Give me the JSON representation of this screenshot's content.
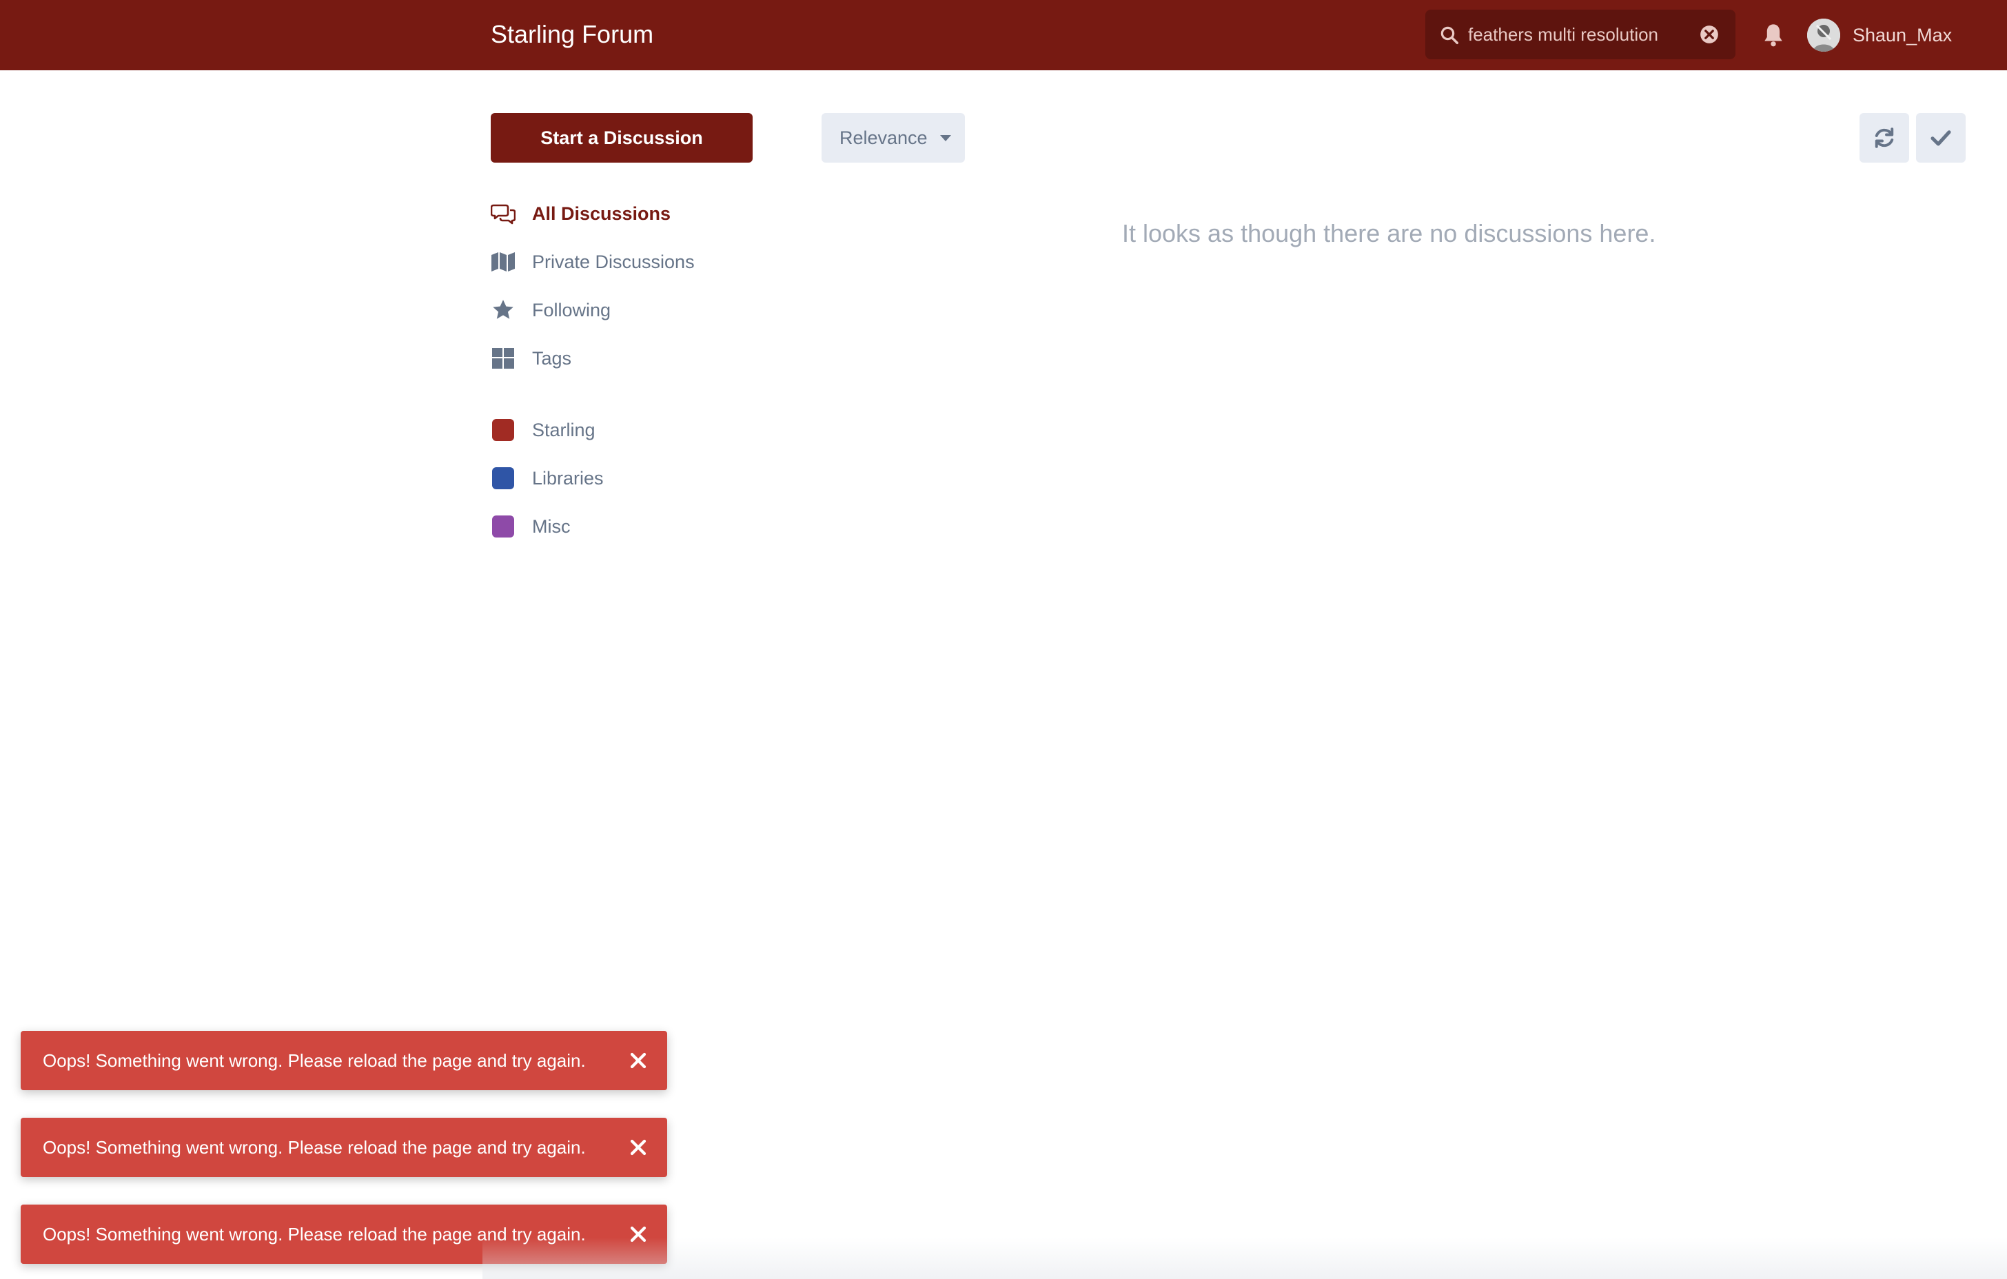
{
  "header": {
    "brand": "Starling Forum",
    "search_value": "feathers multi resolution",
    "username": "Shaun_Max",
    "icons": {
      "search": "search-icon",
      "clear": "clear-search-icon",
      "notifications": "bell-icon",
      "avatar": "avatar"
    }
  },
  "toolbar": {
    "start_label": "Start a Discussion",
    "sort_label": "Relevance",
    "refresh_icon": "refresh-icon",
    "mark_read_icon": "check-icon"
  },
  "nav": {
    "items": [
      {
        "label": "All Discussions",
        "icon": "comments-icon",
        "active": true
      },
      {
        "label": "Private Discussions",
        "icon": "map-icon",
        "active": false
      },
      {
        "label": "Following",
        "icon": "star-icon",
        "active": false
      },
      {
        "label": "Tags",
        "icon": "tags-grid-icon",
        "active": false
      }
    ],
    "tags": [
      {
        "label": "Starling",
        "color": "#a12b23"
      },
      {
        "label": "Libraries",
        "color": "#2f55a6"
      },
      {
        "label": "Misc",
        "color": "#8e4aa8"
      }
    ]
  },
  "main": {
    "empty_message": "It looks as though there are no discussions here."
  },
  "alerts": [
    {
      "message": "Oops! Something went wrong. Please reload the page and try again."
    },
    {
      "message": "Oops! Something went wrong. Please reload the page and try again."
    },
    {
      "message": "Oops! Something went wrong. Please reload the page and try again."
    }
  ],
  "colors": {
    "header_bg": "#771a12",
    "primary": "#771a12",
    "alert_bg": "#d0473f",
    "muted_text": "#667488"
  }
}
